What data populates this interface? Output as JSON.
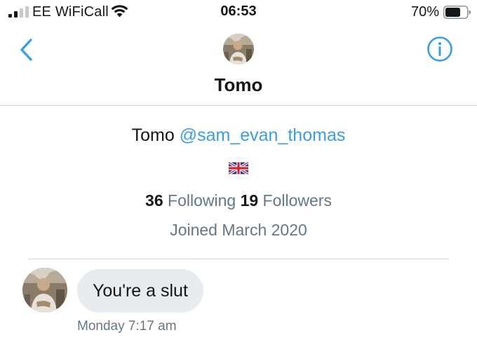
{
  "status_bar": {
    "carrier": "EE WiFiCall",
    "time": "06:53",
    "battery_percent": "70%",
    "battery_level": 0.7,
    "signal_icon": "cellular-signal-icon",
    "wifi_icon": "wifi-icon",
    "battery_icon": "battery-icon"
  },
  "nav": {
    "title": "Tomo",
    "back_icon": "chevron-left-icon",
    "info_icon": "info-icon",
    "accent_color": "#3a9ee0"
  },
  "profile": {
    "name": "Tomo",
    "handle": "@sam_evan_thomas",
    "flag_icon": "uk-flag-icon",
    "following_count": "36",
    "following_label": "Following",
    "followers_count": "19",
    "followers_label": "Followers",
    "joined": "Joined March 2020"
  },
  "messages": [
    {
      "text": "You're a slut",
      "timestamp": "Monday 7:17 am",
      "bubble_color": "#e6ecf0"
    }
  ]
}
